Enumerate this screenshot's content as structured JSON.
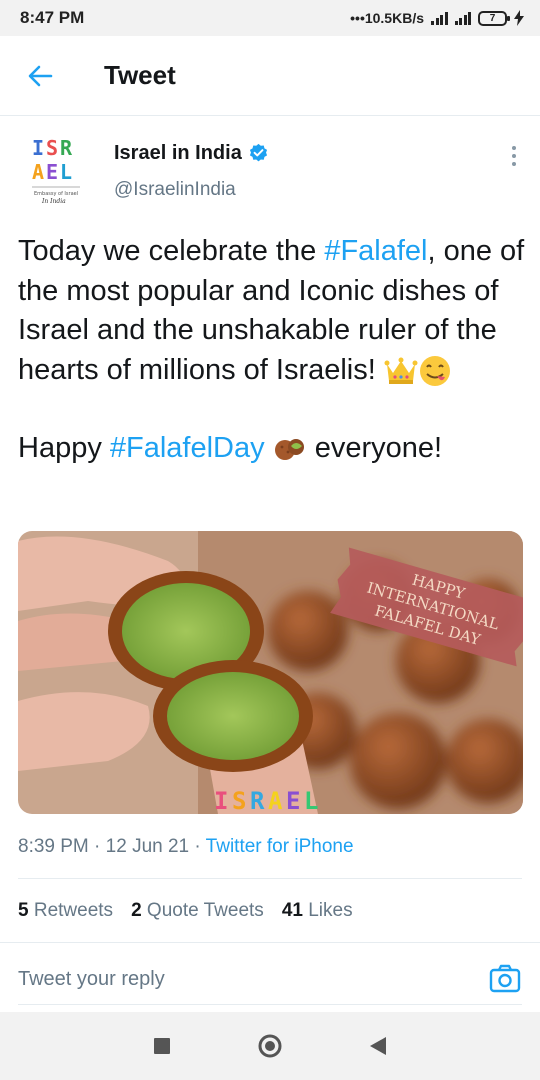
{
  "status_bar": {
    "time": "8:47 PM",
    "network_speed": "•••10.5KB/s",
    "battery": "7"
  },
  "header": {
    "title": "Tweet",
    "back_icon": "arrow-left-icon"
  },
  "author": {
    "name": "Israel in India",
    "handle": "@IsraelinIndia",
    "verified": true,
    "logo_text": "ISRAEL"
  },
  "tweet": {
    "line1_pre": "Today we celebrate the ",
    "line1_tag": "#Falafel",
    "line1_post": ", one of the most popular and Iconic dishes of Israel and the unshakable ruler of the hearts of millions of Israelis! ",
    "line2_pre": "Happy ",
    "line2_tag": "#FalafelDay",
    "line2_post": " everyone!"
  },
  "media": {
    "banner_line1": "HAPPY",
    "banner_line2": "INTERNATIONAL",
    "banner_line3": "FALAFEL DAY",
    "watermark": "ISRAEL"
  },
  "meta": {
    "time": "8:39 PM",
    "date": "12 Jun 21",
    "source": "Twitter for iPhone"
  },
  "stats": {
    "retweets_count": "5",
    "retweets_label": "Retweets",
    "quotes_count": "2",
    "quotes_label": "Quote Tweets",
    "likes_count": "41",
    "likes_label": "Likes"
  },
  "reply": {
    "placeholder": "Tweet your reply"
  },
  "colors": {
    "accent": "#1da1f2",
    "text": "#14171a",
    "muted": "#657786"
  }
}
